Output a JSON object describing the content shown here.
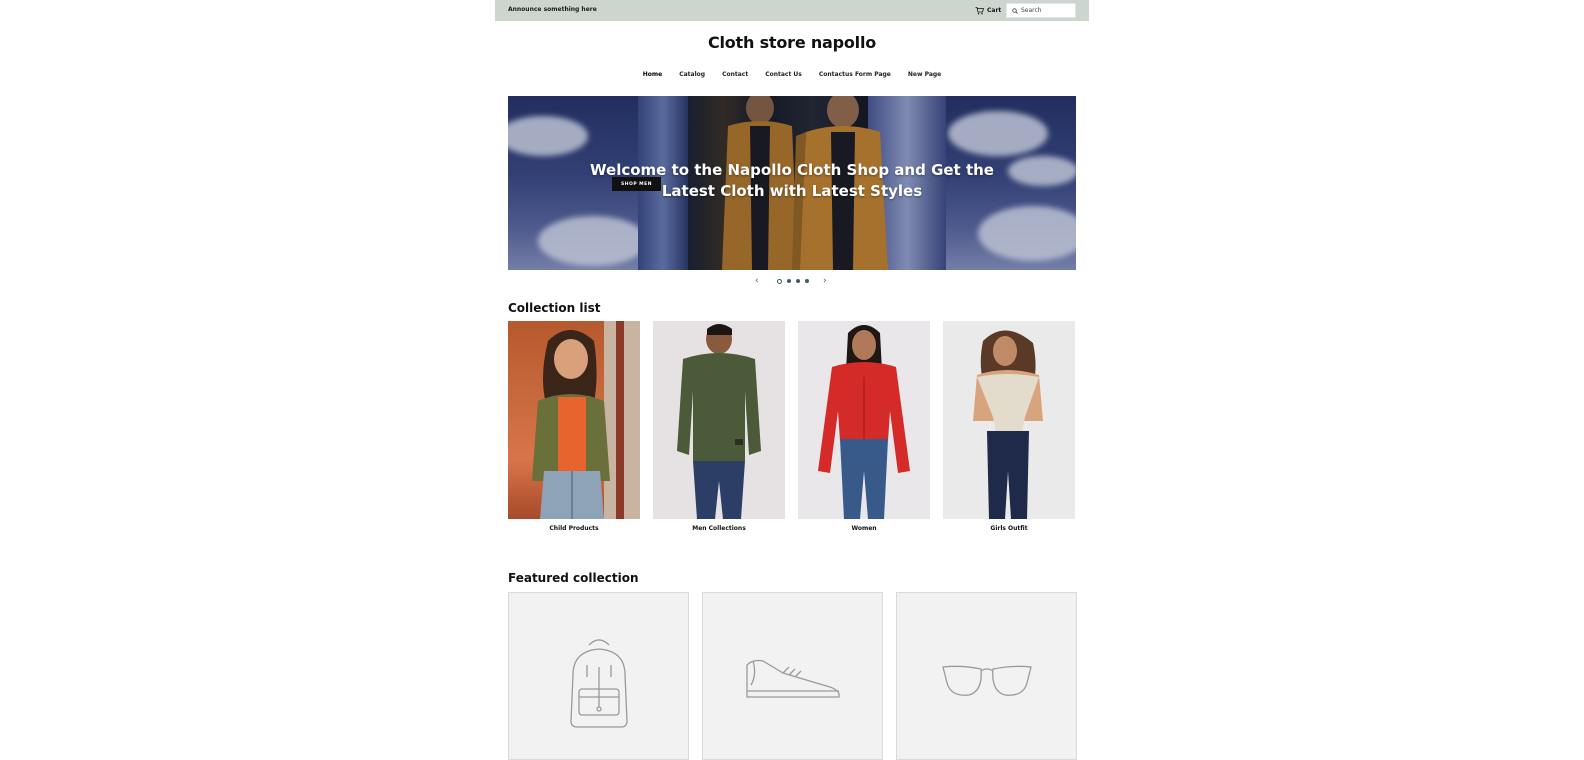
{
  "announcement": {
    "text": "Announce something here"
  },
  "header": {
    "cart_label": "Cart",
    "search_placeholder": "Search",
    "site_title": "Cloth store napollo"
  },
  "nav": {
    "items": [
      {
        "label": "Home"
      },
      {
        "label": "Catalog"
      },
      {
        "label": "Contact"
      },
      {
        "label": "Contact Us"
      },
      {
        "label": "Contactus Form Page"
      },
      {
        "label": "New Page"
      }
    ]
  },
  "hero": {
    "title": "Welcome to the Napollo Cloth Shop and Get the Latest Cloth with Latest Styles",
    "button_label": "SHOP MEN",
    "prev_icon": "chevron-left-icon",
    "next_icon": "chevron-right-icon",
    "slide_count": 4,
    "active_slide": 1
  },
  "collection_list": {
    "title": "Collection list",
    "items": [
      {
        "label": "Child Products"
      },
      {
        "label": "Men Collections"
      },
      {
        "label": "Women"
      },
      {
        "label": "Girls Outfit"
      }
    ]
  },
  "featured_collection": {
    "title": "Featured collection",
    "items": [
      {
        "icon": "backpack-icon"
      },
      {
        "icon": "sneaker-icon"
      },
      {
        "icon": "glasses-icon"
      }
    ]
  },
  "colors": {
    "announcement_bg": "#ccd6cf",
    "dot_active": "#3a5e66",
    "placeholder_bg": "#f2f2f2"
  }
}
